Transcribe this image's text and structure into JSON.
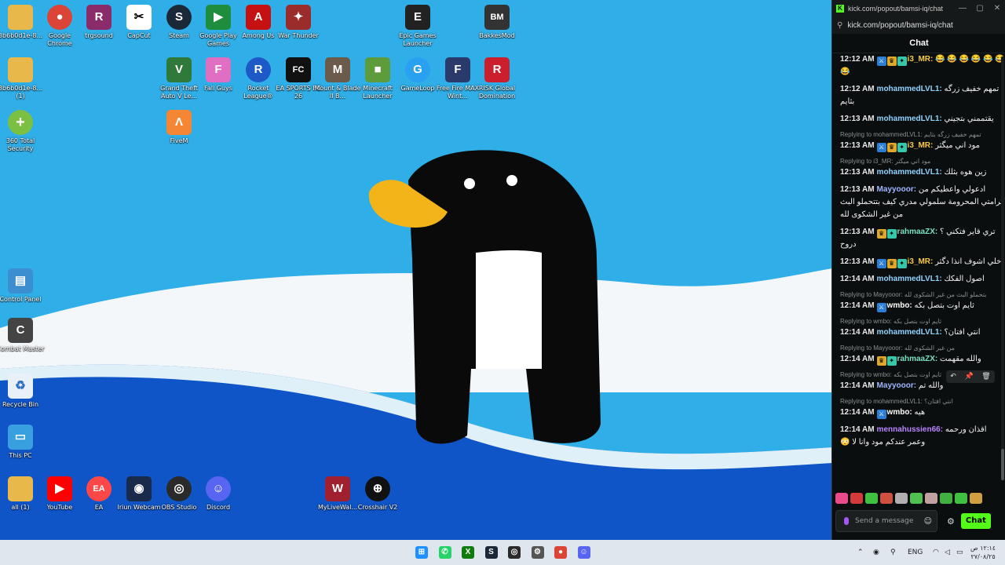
{
  "desktop": {
    "icons": [
      {
        "label": "3b6b0d1e-8...",
        "icon": "folder-icon",
        "color": "#e8b84a",
        "glyph": ""
      },
      {
        "label": "Google Chrome",
        "icon": "chrome-icon",
        "color": "#db4437",
        "glyph": "●"
      },
      {
        "label": "trgsound",
        "icon": "winrar-icon",
        "color": "#8a2b6a",
        "glyph": "R"
      },
      {
        "label": "CapCut",
        "icon": "capcut-icon",
        "color": "#ffffff",
        "glyph": "✂"
      },
      {
        "label": "Steam",
        "icon": "steam-icon",
        "color": "#1b2838",
        "glyph": "S"
      },
      {
        "label": "Google Play Games",
        "icon": "play-games-icon",
        "color": "#1e8e3e",
        "glyph": "▶"
      },
      {
        "label": "Among Us",
        "icon": "among-us-icon",
        "color": "#c51111",
        "glyph": "A"
      },
      {
        "label": "War Thunder",
        "icon": "war-thunder-icon",
        "color": "#9b2c2c",
        "glyph": "✦"
      },
      {
        "label": "Epic Games Launcher",
        "icon": "epic-games-icon",
        "color": "#222222",
        "glyph": "E"
      },
      {
        "label": "BakkesMod",
        "icon": "bakkesmod-icon",
        "color": "#333333",
        "glyph": "BM"
      },
      {
        "label": "3b6b0d1e-8... (1)",
        "icon": "folder-icon",
        "color": "#e8b84a",
        "glyph": ""
      },
      {
        "label": "Grand Theft Auto V Le...",
        "icon": "gta-icon",
        "color": "#2f7a3a",
        "glyph": "V"
      },
      {
        "label": "Fall Guys",
        "icon": "fall-guys-icon",
        "color": "#e06ec2",
        "glyph": "F"
      },
      {
        "label": "Rocket League®",
        "icon": "rocket-league-icon",
        "color": "#1d5ac8",
        "glyph": "R"
      },
      {
        "label": "EA SPORTS FC 26",
        "icon": "ea-fc-icon",
        "color": "#111111",
        "glyph": "FC"
      },
      {
        "label": "Mount & Blade II B...",
        "icon": "mount-blade-icon",
        "color": "#6b5b4b",
        "glyph": "M"
      },
      {
        "label": "Minecraft Launcher",
        "icon": "minecraft-icon",
        "color": "#5d9b3b",
        "glyph": "■"
      },
      {
        "label": "GameLoop",
        "icon": "gameloop-icon",
        "color": "#2aa0f0",
        "glyph": "G"
      },
      {
        "label": "Free Fire MAX Wint...",
        "icon": "free-fire-icon",
        "color": "#2a3a6a",
        "glyph": "F"
      },
      {
        "label": "RISK Global Domination",
        "icon": "risk-icon",
        "color": "#cc1f2d",
        "glyph": "R"
      },
      {
        "label": "360 Total Security",
        "icon": "360-security-icon",
        "color": "#7bc043",
        "glyph": "+"
      },
      {
        "label": "FiveM",
        "icon": "fivem-icon",
        "color": "#f58634",
        "glyph": "Λ"
      },
      {
        "label": "Control Panel",
        "icon": "control-panel-icon",
        "color": "#3b8fd0",
        "glyph": "▤"
      },
      {
        "label": "Combat Master",
        "icon": "combat-master-icon",
        "color": "#444444",
        "glyph": "C"
      },
      {
        "label": "Recycle Bin",
        "icon": "recycle-bin-icon",
        "color": "#e8f0f8",
        "glyph": "♻"
      },
      {
        "label": "This PC",
        "icon": "this-pc-icon",
        "color": "#39a0e0",
        "glyph": "▭"
      },
      {
        "label": "all (1)",
        "icon": "folder-icon",
        "color": "#e8b84a",
        "glyph": ""
      },
      {
        "label": "YouTube",
        "icon": "youtube-icon",
        "color": "#ff0000",
        "glyph": "▶"
      },
      {
        "label": "EA",
        "icon": "ea-icon",
        "color": "#ff4747",
        "glyph": "EA"
      },
      {
        "label": "Iriun Webcam",
        "icon": "iriun-webcam-icon",
        "color": "#1a2a4a",
        "glyph": "◉"
      },
      {
        "label": "OBS Studio",
        "icon": "obs-icon",
        "color": "#2a2a2a",
        "glyph": "◎"
      },
      {
        "label": "Discord",
        "icon": "discord-icon",
        "color": "#5865f2",
        "glyph": "☺"
      },
      {
        "label": "MyLiveWal...",
        "icon": "mylivewallpaper-icon",
        "color": "#a02030",
        "glyph": "W"
      },
      {
        "label": "Crosshair V2",
        "icon": "crosshair-icon",
        "color": "#111111",
        "glyph": "⊕"
      }
    ]
  },
  "chat_window": {
    "title": "kick.com/popout/bamsi-iq/chat",
    "url": "kick.com/popout/bamsi-iq/chat",
    "header": "Chat",
    "messages": [
      {
        "time": "12:12 AM",
        "badges": [
          "mod",
          "crown",
          "sub"
        ],
        "user": "i3_MR:",
        "user_color": "#f7c948",
        "text": "😂 😂 😂 😂 😂 😂 😂",
        "reply": ""
      },
      {
        "time": "12:12 AM",
        "badges": [],
        "user": "mohammedLVL1:",
        "user_color": "#8fd3ff",
        "text": "تمهم خفيف زرگه بثايم",
        "reply": ""
      },
      {
        "time": "12:13 AM",
        "badges": [],
        "user": "mohammedLVL1:",
        "user_color": "#8fd3ff",
        "text": "يقتممني بتجيني",
        "reply": ""
      },
      {
        "time": "12:13 AM",
        "badges": [
          "mod",
          "crown",
          "sub"
        ],
        "user": "i3_MR:",
        "user_color": "#f7c948",
        "text": "مود اني ميگثر",
        "reply": "Replying to mohammedLVL1: تمهم خفيف زرگه بثايم"
      },
      {
        "time": "12:13 AM",
        "badges": [],
        "user": "mohammedLVL1:",
        "user_color": "#8fd3ff",
        "text": "زين هوه بثلك",
        "reply": "Replying to i3_MR: مود اني ميگثر"
      },
      {
        "time": "12:13 AM",
        "badges": [],
        "user": "Mayyooor:",
        "user_color": "#9fb7ff",
        "text": "ادعولي واعطيكم من كرامتي المحرومة سلمولي مدري كيف بتتحملو البث من غير الشكوى لله",
        "reply": ""
      },
      {
        "time": "12:13 AM",
        "badges": [
          "crown",
          "sub"
        ],
        "user": "rahmaaZX:",
        "user_color": "#7ce0c0",
        "text": "تري قاير فتكني ؟ دروح",
        "reply": ""
      },
      {
        "time": "12:13 AM",
        "badges": [
          "mod",
          "crown",
          "sub"
        ],
        "user": "i3_MR:",
        "user_color": "#f7c948",
        "text": "خلي اشوف انذا دگثر",
        "reply": ""
      },
      {
        "time": "12:14 AM",
        "badges": [],
        "user": "mohammedLVL1:",
        "user_color": "#8fd3ff",
        "text": "اصول الفكك",
        "reply": ""
      },
      {
        "time": "12:14 AM",
        "badges": [
          "mod"
        ],
        "user": "wmbo:",
        "user_color": "#ffffff",
        "text": "ثايم اوت بتصل بكه",
        "reply": "Replying to Mayyooor: بتحملو البث من غير الشكوى لله"
      },
      {
        "time": "12:14 AM",
        "badges": [],
        "user": "mohammedLVL1:",
        "user_color": "#8fd3ff",
        "text": "انتي افتان؟",
        "reply": "Replying to wmbo: ثايم اوت بتصل بكه"
      },
      {
        "time": "12:14 AM",
        "badges": [
          "crown",
          "sub"
        ],
        "user": "rahmaaZX:",
        "user_color": "#7ce0c0",
        "text": "والله مقهمت",
        "reply": "Replying to Mayyooor: من غير الشكوى لله"
      },
      {
        "time": "12:14 AM",
        "badges": [],
        "user": "Mayyooor:",
        "user_color": "#9fb7ff",
        "text": "والله تم",
        "reply": "Replying to wmbo: ثايم اوت بتصل بكه"
      },
      {
        "time": "12:14 AM",
        "badges": [
          "mod"
        ],
        "user": "wmbo:",
        "user_color": "#ffffff",
        "text": "هيه",
        "reply": "Replying to mohammedLVL1: انتي افتان؟"
      },
      {
        "time": "12:14 AM",
        "badges": [],
        "user": "mennahussien66:",
        "user_color": "#b983ff",
        "text": "اقذان ورحمه وعمر عندكم مود وانا لا 😳",
        "reply": ""
      }
    ],
    "emotes": [
      "#e84a8a",
      "#d43a3a",
      "#40c040",
      "#d05040",
      "#b0b0b0",
      "#50c050",
      "#c0a0a0",
      "#40b040",
      "#40c040",
      "#d0a040"
    ],
    "input_placeholder": "Send a message",
    "send_label": "Chat",
    "accent": "#53fc18"
  },
  "taskbar": {
    "language": "ENG",
    "time": "١٢:١٤ ص",
    "date": "٢٧/٠٨/٢٥",
    "apps": [
      {
        "name": "start-icon",
        "color": "#1e90ff",
        "glyph": "⊞"
      },
      {
        "name": "whatsapp-icon",
        "color": "#25d366",
        "glyph": "✆"
      },
      {
        "name": "xbox-icon",
        "color": "#107c10",
        "glyph": "X"
      },
      {
        "name": "steam-taskbar-icon",
        "color": "#1b2838",
        "glyph": "S"
      },
      {
        "name": "obs-taskbar-icon",
        "color": "#2a2a2a",
        "glyph": "◎"
      },
      {
        "name": "settings-taskbar-icon",
        "color": "#555555",
        "glyph": "⚙"
      },
      {
        "name": "chrome-taskbar-icon",
        "color": "#db4437",
        "glyph": "●"
      },
      {
        "name": "discord-taskbar-icon",
        "color": "#5865f2",
        "glyph": "☺"
      }
    ]
  }
}
